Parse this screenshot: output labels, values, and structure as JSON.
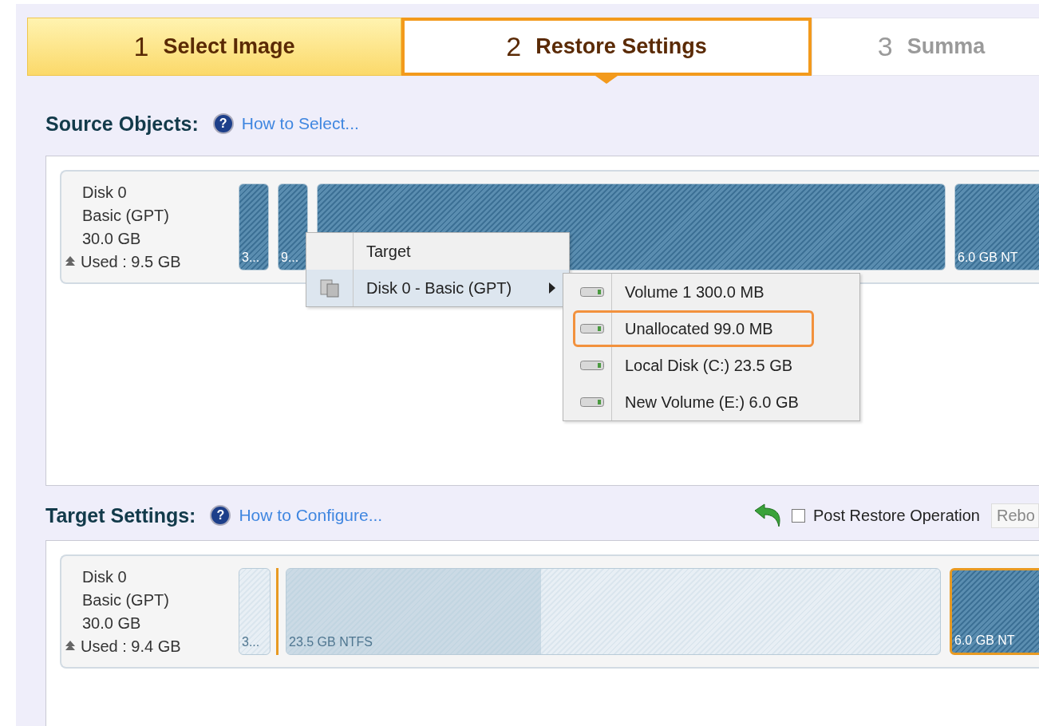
{
  "steps": [
    {
      "number": "1",
      "label": "Select Image",
      "selected": false,
      "completed": true
    },
    {
      "number": "2",
      "label": "Restore Settings",
      "selected": true,
      "completed": false
    },
    {
      "number": "3",
      "label": "Summa",
      "selected": false,
      "completed": false
    }
  ],
  "source": {
    "title": "Source Objects:",
    "help_mark": "?",
    "help_link": "How to Select...",
    "disk": {
      "name": "Disk 0",
      "type": "Basic (GPT)",
      "size": "30.0 GB",
      "used": "Used : 9.5 GB",
      "partitions": [
        {
          "kind": "filled",
          "label": "3...",
          "selected": false
        },
        {
          "kind": "filled",
          "label": "9...",
          "selected": false
        },
        {
          "kind": "filled",
          "selected": false
        },
        {
          "kind": "filled",
          "label": "6.0 GB NT",
          "selected": false
        }
      ]
    }
  },
  "context_menu": {
    "items": [
      {
        "label": "Target",
        "highlighted": false,
        "submenu": false
      },
      {
        "label": "Disk 0 - Basic (GPT)",
        "highlighted": true,
        "submenu": true
      }
    ]
  },
  "submenu": {
    "items": [
      {
        "label": "Volume 1 300.0 MB",
        "selected": false
      },
      {
        "label": "Unallocated 99.0 MB",
        "selected": true
      },
      {
        "label": "Local Disk (C:) 23.5 GB",
        "selected": false
      },
      {
        "label": "New Volume (E:) 6.0 GB",
        "selected": false
      }
    ]
  },
  "target": {
    "title": "Target Settings:",
    "help_mark": "?",
    "help_link": "How to Configure...",
    "post_restore": {
      "label": "Post Restore Operation",
      "checked": false
    },
    "dropdown": {
      "value": "Rebo"
    },
    "disk": {
      "name": "Disk 0",
      "type": "Basic (GPT)",
      "size": "30.0 GB",
      "used": "Used : 9.4 GB",
      "partitions": [
        {
          "kind": "empty",
          "label": "3...",
          "selected": false
        },
        {
          "kind": "marker"
        },
        {
          "kind": "empty",
          "label": "23.5 GB NTFS",
          "level": 0.39,
          "selected": false
        },
        {
          "kind": "filled",
          "label": "6.0 GB NT",
          "selected": true
        }
      ]
    }
  }
}
